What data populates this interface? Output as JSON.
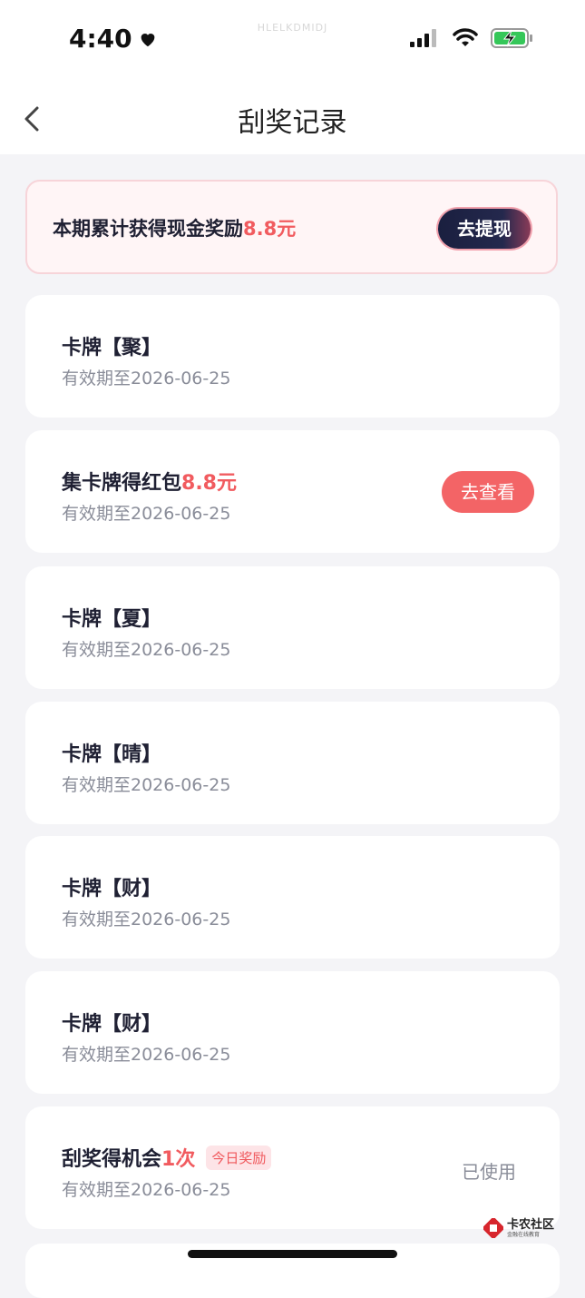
{
  "status": {
    "time": "4:40",
    "watermark": "HLELKDMIDJ"
  },
  "header": {
    "title": "刮奖记录"
  },
  "banner": {
    "prefix": "本期累计获得现金奖励",
    "amount": "8.8元",
    "button_label": "去提现"
  },
  "items": [
    {
      "title": "卡牌【聚】",
      "validity": "有效期至2026-06-25"
    },
    {
      "title_prefix": "集卡牌得红包",
      "title_amount": "8.8元",
      "validity": "有效期至2026-06-25",
      "button_label": "去查看"
    },
    {
      "title": "卡牌【夏】",
      "validity": "有效期至2026-06-25"
    },
    {
      "title": "卡牌【晴】",
      "validity": "有效期至2026-06-25"
    },
    {
      "title": "卡牌【财】",
      "validity": "有效期至2026-06-25"
    },
    {
      "title": "卡牌【财】",
      "validity": "有效期至2026-06-25"
    },
    {
      "title_prefix": "刮奖得机会",
      "title_amount": "1次",
      "tag": "今日奖励",
      "validity": "有效期至2026-06-25",
      "status": "已使用"
    }
  ],
  "footer": {
    "logo_title": "卡农社区",
    "logo_subtitle": "金融在线教育"
  },
  "colors": {
    "accent_red": "#f15b5f",
    "dark_button": "#1a1f3f",
    "background": "#f4f4f7"
  },
  "icons": [
    "heart-icon",
    "signal-icon",
    "wifi-icon",
    "battery-charging-icon",
    "back-chevron-icon"
  ]
}
